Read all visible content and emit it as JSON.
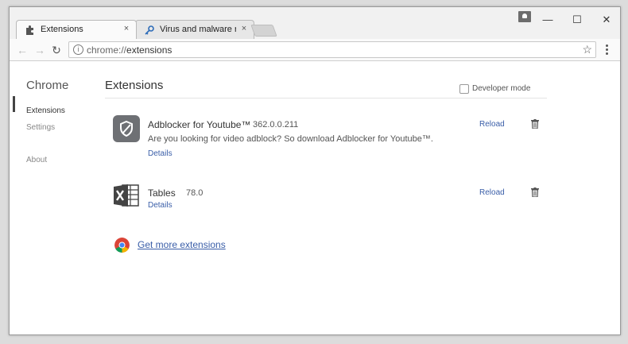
{
  "tabs": [
    {
      "title": "Extensions",
      "close": "×",
      "icon": "puzzle-icon",
      "active": true
    },
    {
      "title": "Virus and malware remo",
      "close": "×",
      "icon": "key-icon",
      "active": false
    }
  ],
  "window_controls": {
    "minimize": "—",
    "maximize": "☐",
    "close": "✕"
  },
  "toolbar": {
    "back": "←",
    "forward": "→",
    "reload": "↻",
    "url_scheme": "chrome://",
    "url_path": "extensions",
    "info": "i",
    "star": "☆"
  },
  "sidebar": {
    "title": "Chrome",
    "items": [
      "Extensions",
      "Settings",
      "About"
    ]
  },
  "main": {
    "title": "Extensions",
    "developer_mode_label": "Developer mode",
    "extensions": [
      {
        "name": "Adblocker for Youtube™",
        "version": "362.0.0.211",
        "description": "Are you looking for video adblock? So download Adblocker for Youtube™.",
        "details_label": "Details",
        "reload_label": "Reload",
        "icon": "shield-icon"
      },
      {
        "name": "Tables",
        "version": "78.0",
        "details_label": "Details",
        "reload_label": "Reload",
        "icon": "excel-icon"
      }
    ],
    "get_more_label": "Get more extensions"
  },
  "colors": {
    "link": "#3a5ea8",
    "accent_dark": "#444444"
  }
}
